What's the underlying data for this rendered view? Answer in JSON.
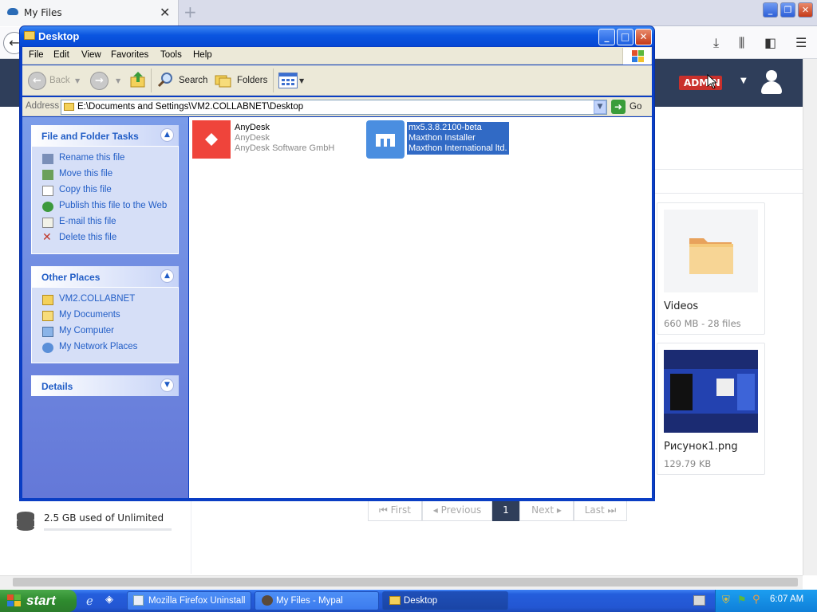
{
  "firefox": {
    "tab_title": "My Files",
    "new_tab": "+"
  },
  "site": {
    "admin_badge": "ADMIN",
    "storage": "2.5 GB used of Unlimited",
    "cards": [
      {
        "title": "Videos",
        "meta": "660 MB - 28 files"
      },
      {
        "title": "Рисунок1.png",
        "meta": "129.79 KB"
      }
    ],
    "pagination": {
      "first": "First",
      "previous": "Previous",
      "current": "1",
      "next": "Next",
      "last": "Last"
    }
  },
  "explorer": {
    "title": "Desktop",
    "menu": [
      "File",
      "Edit",
      "View",
      "Favorites",
      "Tools",
      "Help"
    ],
    "toolbar": {
      "back": "Back",
      "search": "Search",
      "folders": "Folders"
    },
    "address_label": "Address",
    "address": "E:\\Documents and Settings\\VM2.COLLABNET\\Desktop",
    "go": "Go",
    "tasks": {
      "file_folder_title": "File and Folder Tasks",
      "file_folder_items": [
        "Rename this file",
        "Move this file",
        "Copy this file",
        "Publish this file to the Web",
        "E-mail this file",
        "Delete this file"
      ],
      "other_places_title": "Other Places",
      "other_places_items": [
        "VM2.COLLABNET",
        "My Documents",
        "My Computer",
        "My Network Places"
      ],
      "details_title": "Details"
    },
    "files": [
      {
        "name": "AnyDesk",
        "line2": "AnyDesk",
        "line3": "AnyDesk Software GmbH"
      },
      {
        "name": "mx5.3.8.2100-beta",
        "line2": "Maxthon Installer",
        "line3": "Maxthon International ltd."
      }
    ]
  },
  "taskbar": {
    "start": "start",
    "tasks": [
      "Mozilla Firefox Uninstall",
      "My Files - Mypal",
      "Desktop"
    ],
    "clock": "6:07 AM"
  },
  "colors": {
    "xp_blue": "#0a3ec4",
    "header": "#2f3e5a",
    "admin": "#c9302c",
    "selection": "#316ac5"
  }
}
